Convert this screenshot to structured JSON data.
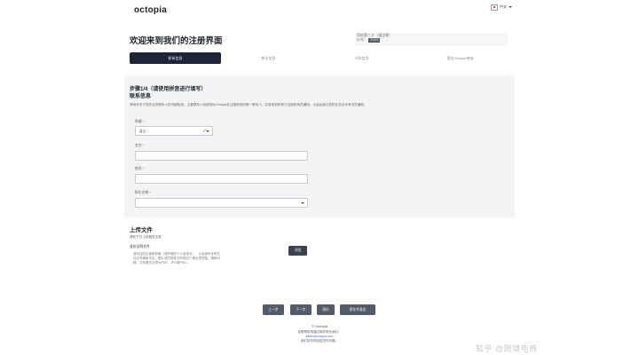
{
  "header": {
    "logo": "octopia",
    "language": "中文",
    "language_flag_icon": "japan-flag-icon"
  },
  "page": {
    "title": "欢迎来到我们的注册界面",
    "info_line1": "您的第三方（请注意）",
    "info_line2_prefix": "ID号：",
    "info_line2_code": "XXXX"
  },
  "steps": [
    "联系信息",
    "商业信息",
    "付款信息",
    "提交Octopia审核"
  ],
  "contact": {
    "step_heading": "步骤1/4（请使用拼音进行填写）",
    "heading": "联系信息",
    "description": "请填写关于您的业务联系人的详细信息。主要联系人将被视为Octopia在注册阶段的唯一联系人，并将收到所有与注册相关的通知。以及后续与您的业务合作有关的通知。",
    "fields": [
      {
        "label": "称谓",
        "required": true,
        "value": "女士",
        "type": "select"
      },
      {
        "label": "名字",
        "required": true,
        "value": "",
        "type": "text"
      },
      {
        "label": "姓氏",
        "required": true,
        "value": "",
        "type": "text"
      },
      {
        "label": "职位名称",
        "required": true,
        "value": "",
        "type": "select"
      }
    ]
  },
  "upload": {
    "heading": "上传文件",
    "description": "请在下方上传相关文件",
    "doc_label": "身份证明文件",
    "doc_text": "身份证的正面和背面（或护照的个人信息页），以及身份证明文件必须清晰可见，照片或扫描件中所有四个角必须完整、清晰可辨。文件格式必须为PDF、JPG或PNG。",
    "browse_label": "浏览"
  },
  "actions": {
    "prev": "上一步",
    "next": "下一步",
    "save": "保存",
    "save_exit": "保存并退出"
  },
  "footer": {
    "title": "© Octopia",
    "line1": "如需帮助请通过邮件联系我们：",
    "line2_link": "seller@octopia.com",
    "line3": "我们将尽快回复您的问题。"
  },
  "watermark": "知乎 @跨境电商"
}
